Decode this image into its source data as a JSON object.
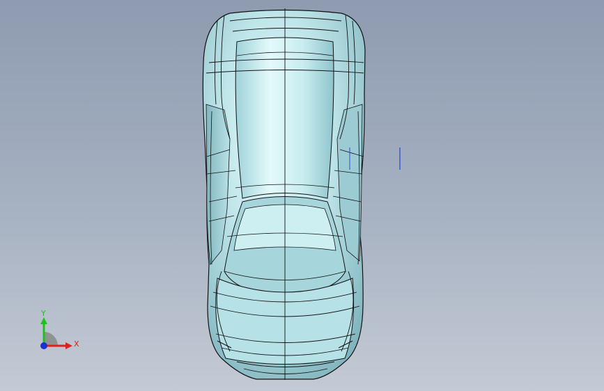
{
  "viewport": {
    "background_top": "#8e9bb0",
    "background_bottom": "#c4cad5"
  },
  "model": {
    "body_color": "#b8e3e8",
    "highlight_color": "#e6fbfc",
    "shadow_color": "#6fa7b2",
    "edge_color": "#111111"
  },
  "triad": {
    "x_label": "X",
    "y_label": "Y",
    "x_color": "#e02020",
    "y_color": "#20c020",
    "origin_color": "#2030d0"
  },
  "cursor_marker_color": "#2a4fd0"
}
